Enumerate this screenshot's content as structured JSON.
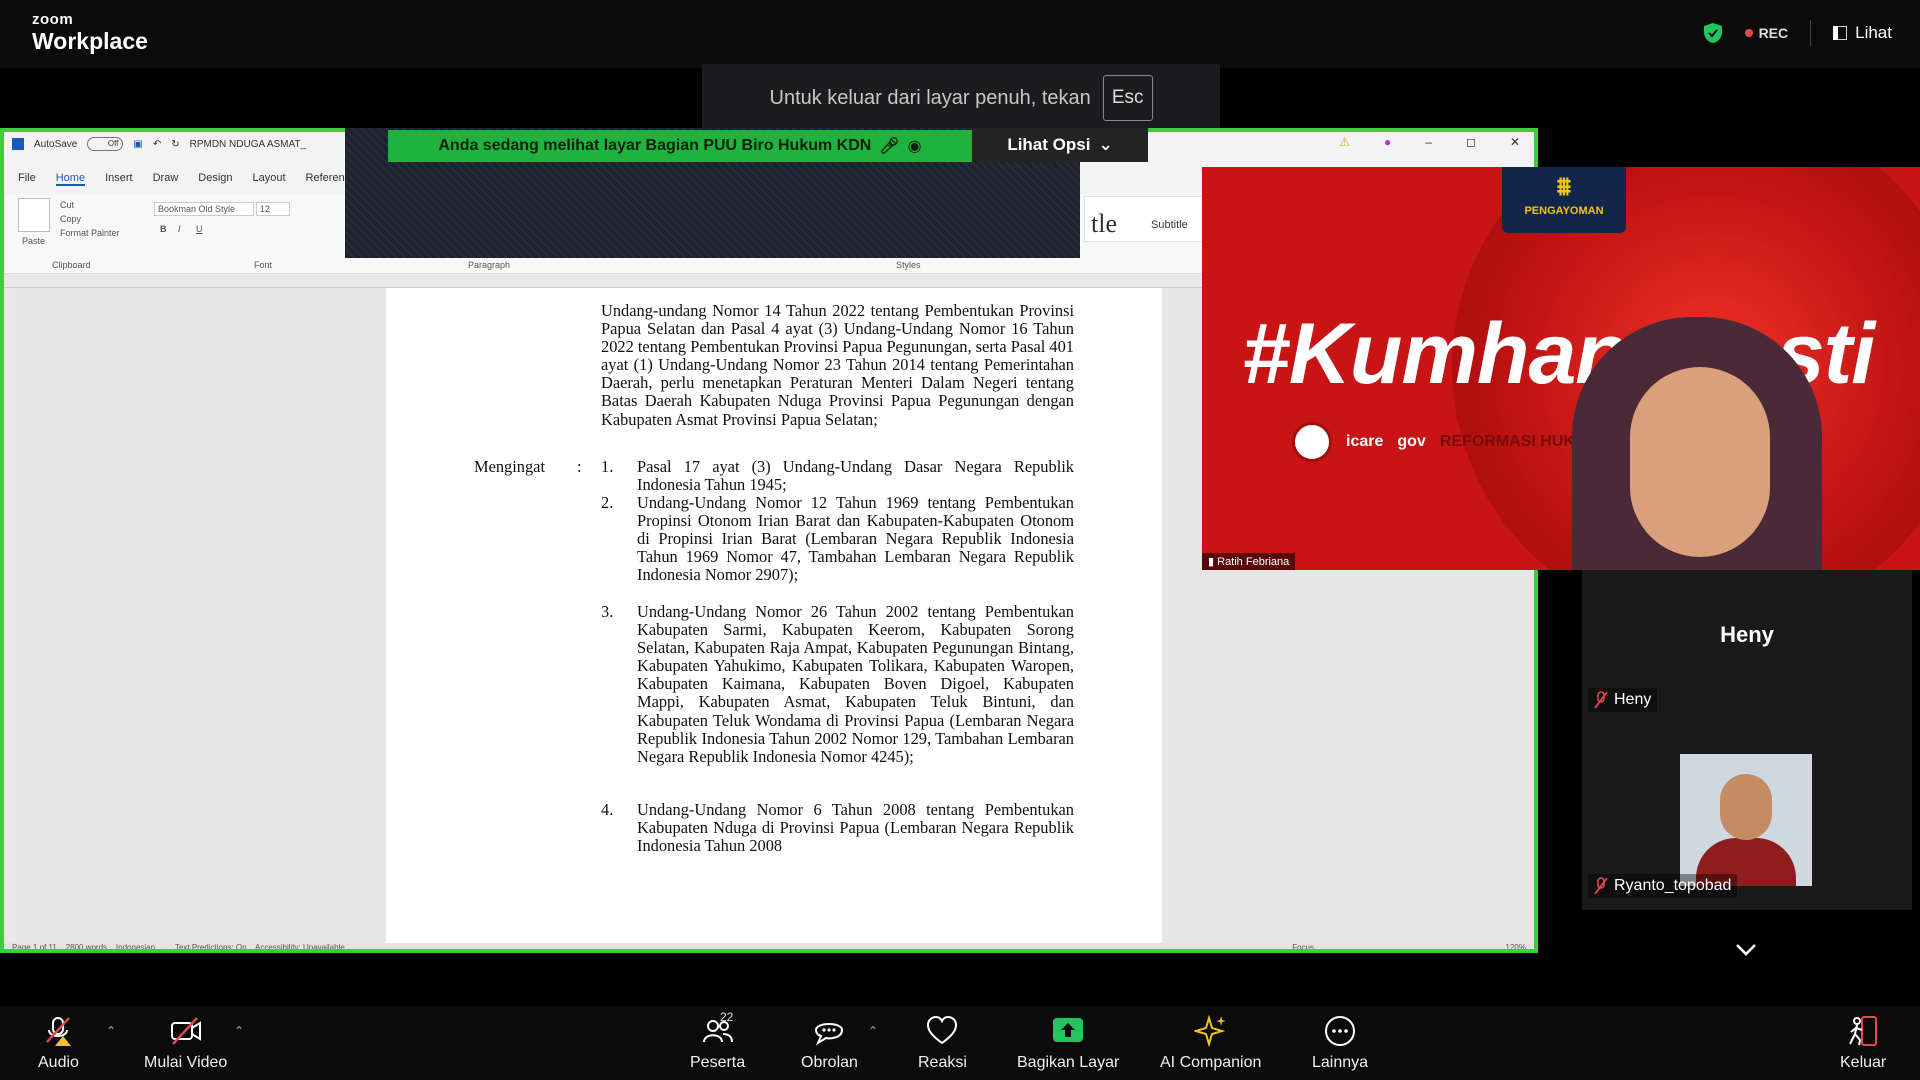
{
  "app": {
    "brand_line1": "zoom",
    "brand_line2": "Workplace"
  },
  "topbar": {
    "rec_label": "REC",
    "view_label": "Lihat",
    "rec_color": "#e5484d",
    "shield_color": "#22c55e"
  },
  "fullscreen_banner": {
    "text": "Untuk keluar dari layar penuh, tekan",
    "key": "Esc"
  },
  "share": {
    "label": "Anda sedang melihat layar  Bagian PUU Biro Hukum KDN",
    "options": "Lihat Opsi",
    "border_color": "#3ccf3c"
  },
  "word": {
    "autosave": "AutoSave",
    "autosave_state": "Off",
    "doc_name": "RPMDN NDUGA ASMAT_",
    "tabs": [
      "File",
      "Home",
      "Insert",
      "Draw",
      "Design",
      "Layout",
      "References"
    ],
    "font_name": "Bookman Old Style",
    "font_size": "12",
    "clipboard": {
      "paste": "Paste",
      "cut": "Cut",
      "copy": "Copy",
      "format_painter": "Format Painter"
    },
    "group_labels": {
      "clipboard": "Clipboard",
      "font": "Font",
      "paragraph": "Paragraph",
      "styles": "Styles"
    },
    "styles": {
      "title_fragment": "tle",
      "subtitle": "Subtitle"
    },
    "status": {
      "page": "Page 1 of 11",
      "words": "2800 words",
      "language": "Indonesian",
      "predictions": "Text Predictions: On",
      "accessibility": "Accessibility: Unavailable",
      "focus": "Focus",
      "zoom": "120%"
    }
  },
  "document": {
    "intro": "Undang-undang Nomor 14 Tahun 2022 tentang Pembentukan Provinsi Papua Selatan dan Pasal 4 ayat (3) Undang-Undang Nomor 16 Tahun 2022 tentang Pembentukan Provinsi Papua Pegunungan, serta Pasal 401 ayat (1) Undang-Undang Nomor 23 Tahun 2014 tentang Pemerintahan Daerah, perlu menetapkan Peraturan Menteri Dalam Negeri tentang Batas Daerah Kabupaten Nduga Provinsi Papua Pegunungan dengan Kabupaten Asmat Provinsi Papua Selatan;",
    "mengingat_label": "Mengingat",
    "colon": ":",
    "items": [
      {
        "num": "1.",
        "text": "Pasal 17 ayat (3) Undang-Undang Dasar Negara Republik Indonesia Tahun 1945;"
      },
      {
        "num": "2.",
        "text": "Undang-Undang Nomor 12 Tahun 1969 tentang Pembentukan Propinsi Otonom Irian Barat dan Kabupaten-Kabupaten Otonom di Propinsi Irian Barat (Lembaran Negara Republik Indonesia Tahun 1969 Nomor 47, Tambahan Lembaran Negara Republik Indonesia Nomor 2907);"
      },
      {
        "num": "3.",
        "text": "Undang-Undang Nomor 26 Tahun 2002 tentang Pembentukan Kabupaten Sarmi, Kabupaten Keerom, Kabupaten Sorong Selatan, Kabupaten Raja Ampat, Kabupaten Pegunungan Bintang, Kabupaten Yahukimo, Kabupaten Tolikara, Kabupaten Waropen, Kabupaten Kaimana, Kabupaten Boven Digoel, Kabupaten Mappi, Kabupaten Asmat, Kabupaten Teluk Bintuni, dan Kabupaten Teluk Wondama di Provinsi Papua (Lembaran Negara Republik Indonesia Tahun 2002 Nomor 129, Tambahan Lembaran Negara Republik Indonesia Nomor 4245);"
      },
      {
        "num": "4.",
        "text": "Undang-Undang Nomor 6 Tahun 2008 tentang Pembentukan Kabupaten Nduga di Provinsi Papua (Lembaran Negara Republik Indonesia Tahun 2008"
      }
    ]
  },
  "speaker": {
    "hashtag": "#Kumhan",
    "hashtag_tail": "sti",
    "logo_label": "PENGAYOMAN",
    "badges": [
      "icare",
      "gov",
      "REFORMASI HUKUM"
    ],
    "name": "Ratih Febriana"
  },
  "side_panel": {
    "heading": "Heny",
    "participants": [
      {
        "name": "Heny",
        "muted": true
      },
      {
        "name": "Ryanto_topobad",
        "muted": true
      }
    ]
  },
  "toolbar": {
    "audio": "Audio",
    "video": "Mulai Video",
    "participants": "Peserta",
    "participants_count": "22",
    "chat": "Obrolan",
    "reactions": "Reaksi",
    "share": "Bagikan Layar",
    "ai": "AI Companion",
    "more": "Lainnya",
    "leave": "Keluar",
    "share_color": "#22c55e",
    "ai_color": "#f0c419",
    "leave_color": "#e5484d"
  }
}
